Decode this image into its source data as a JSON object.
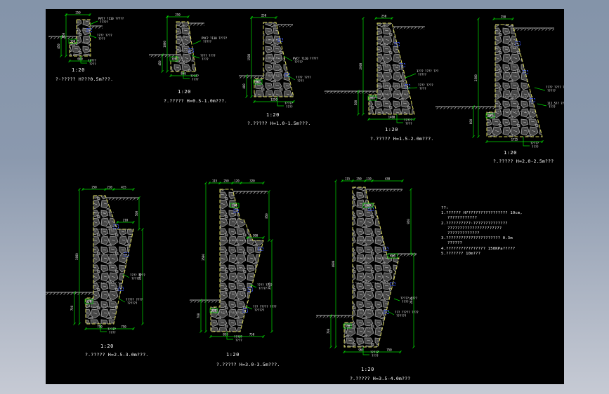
{
  "palette": {
    "dim_color": "#00dd00",
    "outline_color": "#d8d85c",
    "stone_color": "#a8a8a8",
    "text_color": "#ffffff",
    "drain_color": "#3a55f0",
    "ground_color": "#8f8f8f",
    "canvas_color": "#000000"
  },
  "drawings": [
    {
      "title": "?·????? H???0.5m???.",
      "scale": "1:20",
      "dims": [
        "250",
        "600",
        "850",
        "450"
      ],
      "boxed": [
        "300"
      ],
      "leaders": [
        [
          "PVC? ?110 ?????",
          "?????"
        ],
        [
          "???? ????",
          "????"
        ],
        [
          "?????",
          "????"
        ]
      ]
    },
    {
      "title": "?.????? H=0.5-1.0m???.",
      "scale": "1:20",
      "dims": [
        "250",
        "800",
        "1000",
        "450"
      ],
      "boxed": [
        "300"
      ],
      "leaders": [
        [
          "PVC? ?110 ?????",
          "?????"
        ],
        [
          "???? ????",
          "????"
        ],
        [
          "?????",
          "????"
        ]
      ]
    },
    {
      "title": "?.????? H=1.0-1.5m???.",
      "scale": "1:20",
      "dims": [
        "250",
        "1250",
        "1500",
        "400"
      ],
      "boxed": [
        "300"
      ],
      "leaders": [
        [
          "PVC? ?110 ?????",
          "?????"
        ],
        [
          "???? ????",
          "????"
        ],
        [
          "?????",
          "????"
        ]
      ]
    },
    {
      "title": "?.????? H=1.5-2.0m???.",
      "scale": "1:20",
      "dims": [
        "250",
        "1400",
        "2000",
        "500"
      ],
      "boxed": [
        "300"
      ],
      "leaders": [
        [
          "1??? ???? ???",
          "?????"
        ],
        [
          "???? ????",
          "????"
        ],
        [
          "?????",
          "????"
        ]
      ]
    },
    {
      "title": "?.????? H=2.0-2.5m???",
      "scale": "1:20",
      "dims": [
        "250",
        "1725",
        "2500",
        "600"
      ],
      "boxed": [
        "300"
      ],
      "leaders": [
        [
          "???? ???? ???",
          "?????"
        ],
        [
          "112.5?? ????",
          "????"
        ],
        [
          "?????",
          "????"
        ]
      ]
    },
    {
      "title": "?.????? H=2.5-3.0m???.",
      "scale": "1:20",
      "dims": [
        "250",
        "210",
        "415",
        "210",
        "750",
        "750",
        "3000",
        "700",
        "500",
        "1500"
      ],
      "boxed": [
        "300"
      ],
      "leaders": [
        [
          "???? ????",
          "?????"
        ],
        [
          "????? ????",
          "??????"
        ],
        [
          "?????",
          "????"
        ]
      ]
    },
    {
      "title": "?.????? H=3.0-3.5m???.",
      "scale": "1:20",
      "dims": [
        "115",
        "250",
        "120",
        "320",
        "300",
        "850",
        "750",
        "3500",
        "700",
        "850",
        "2625"
      ],
      "boxed": [
        "300",
        "240"
      ],
      "leaders": [
        [
          "???? ????",
          "?????"
        ],
        [
          "??? ????? ????",
          "??????"
        ],
        [
          "?????",
          "????"
        ]
      ]
    },
    {
      "title": "?.????? H=3.5-4.0m???",
      "scale": "1:20",
      "dims": [
        "115",
        "250",
        "110",
        "430",
        "960",
        "750",
        "4000",
        "700",
        "950",
        "2625"
      ],
      "boxed": [
        "300",
        "360",
        "400"
      ],
      "leaders": [
        [
          "????? ????",
          "????"
        ],
        [
          "??? ????? ????",
          "??????"
        ],
        [
          "?????",
          "????"
        ]
      ]
    }
  ],
  "notes": {
    "heading": "??:",
    "lines": [
      "1.?????? H????????????????? 10cm,",
      "????????????",
      "2.??????????·??????????????",
      "??????????????????????",
      "?????????????",
      "3.?????????????????????? 0.3m",
      "??????",
      "4.???????????????? 150KPa?????",
      "5.??????? 10m???"
    ]
  }
}
